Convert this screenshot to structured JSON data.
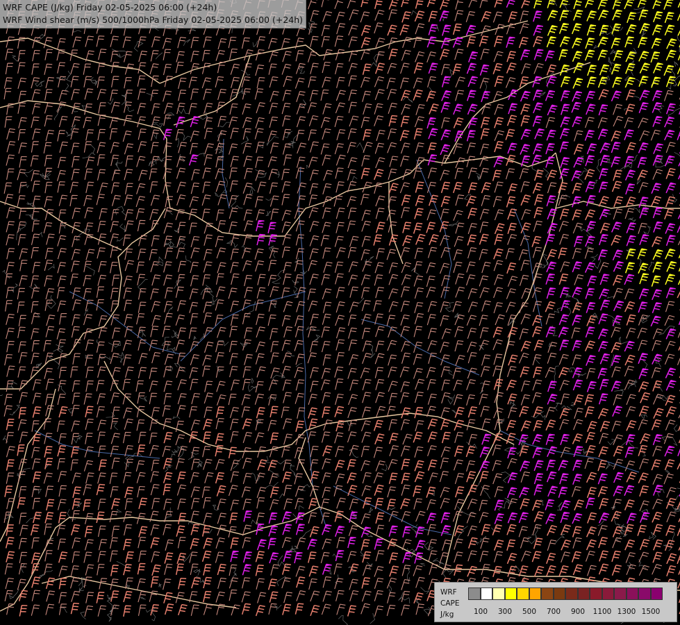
{
  "titles": {
    "line1": "WRF CAPE (J/kg) Friday 02-05-2025 06:00 (+24h)",
    "line2": "WRF Wind shear (m/s) 500/1000hPa Friday 02-05-2025 06:00 (+24h)"
  },
  "legend": {
    "label_line1": "WRF",
    "label_line2": "CAPE",
    "label_line3": "J/kg",
    "tick_labels": [
      "100",
      "300",
      "500",
      "700",
      "900",
      "1100",
      "1300",
      "1500"
    ],
    "colors": [
      "#8c8c8c",
      "#ffffff",
      "#ffffb0",
      "#ffff00",
      "#ffd700",
      "#ffa500",
      "#8b4513",
      "#7a3a10",
      "#7a2a1a",
      "#7a2222",
      "#8a1a2a",
      "#8a1a3a",
      "#8a1a4a",
      "#8a105a",
      "#8a0a6a",
      "#8a006f"
    ]
  },
  "wind_colors": {
    "low": "#c98a7e",
    "mid": "#e8806e",
    "high": "#e020e8",
    "very_high": "#ffff20"
  },
  "map_colors": {
    "border": "#e8c8a0",
    "river": "#4a6aa8",
    "contour": "#8c8c8c"
  }
}
